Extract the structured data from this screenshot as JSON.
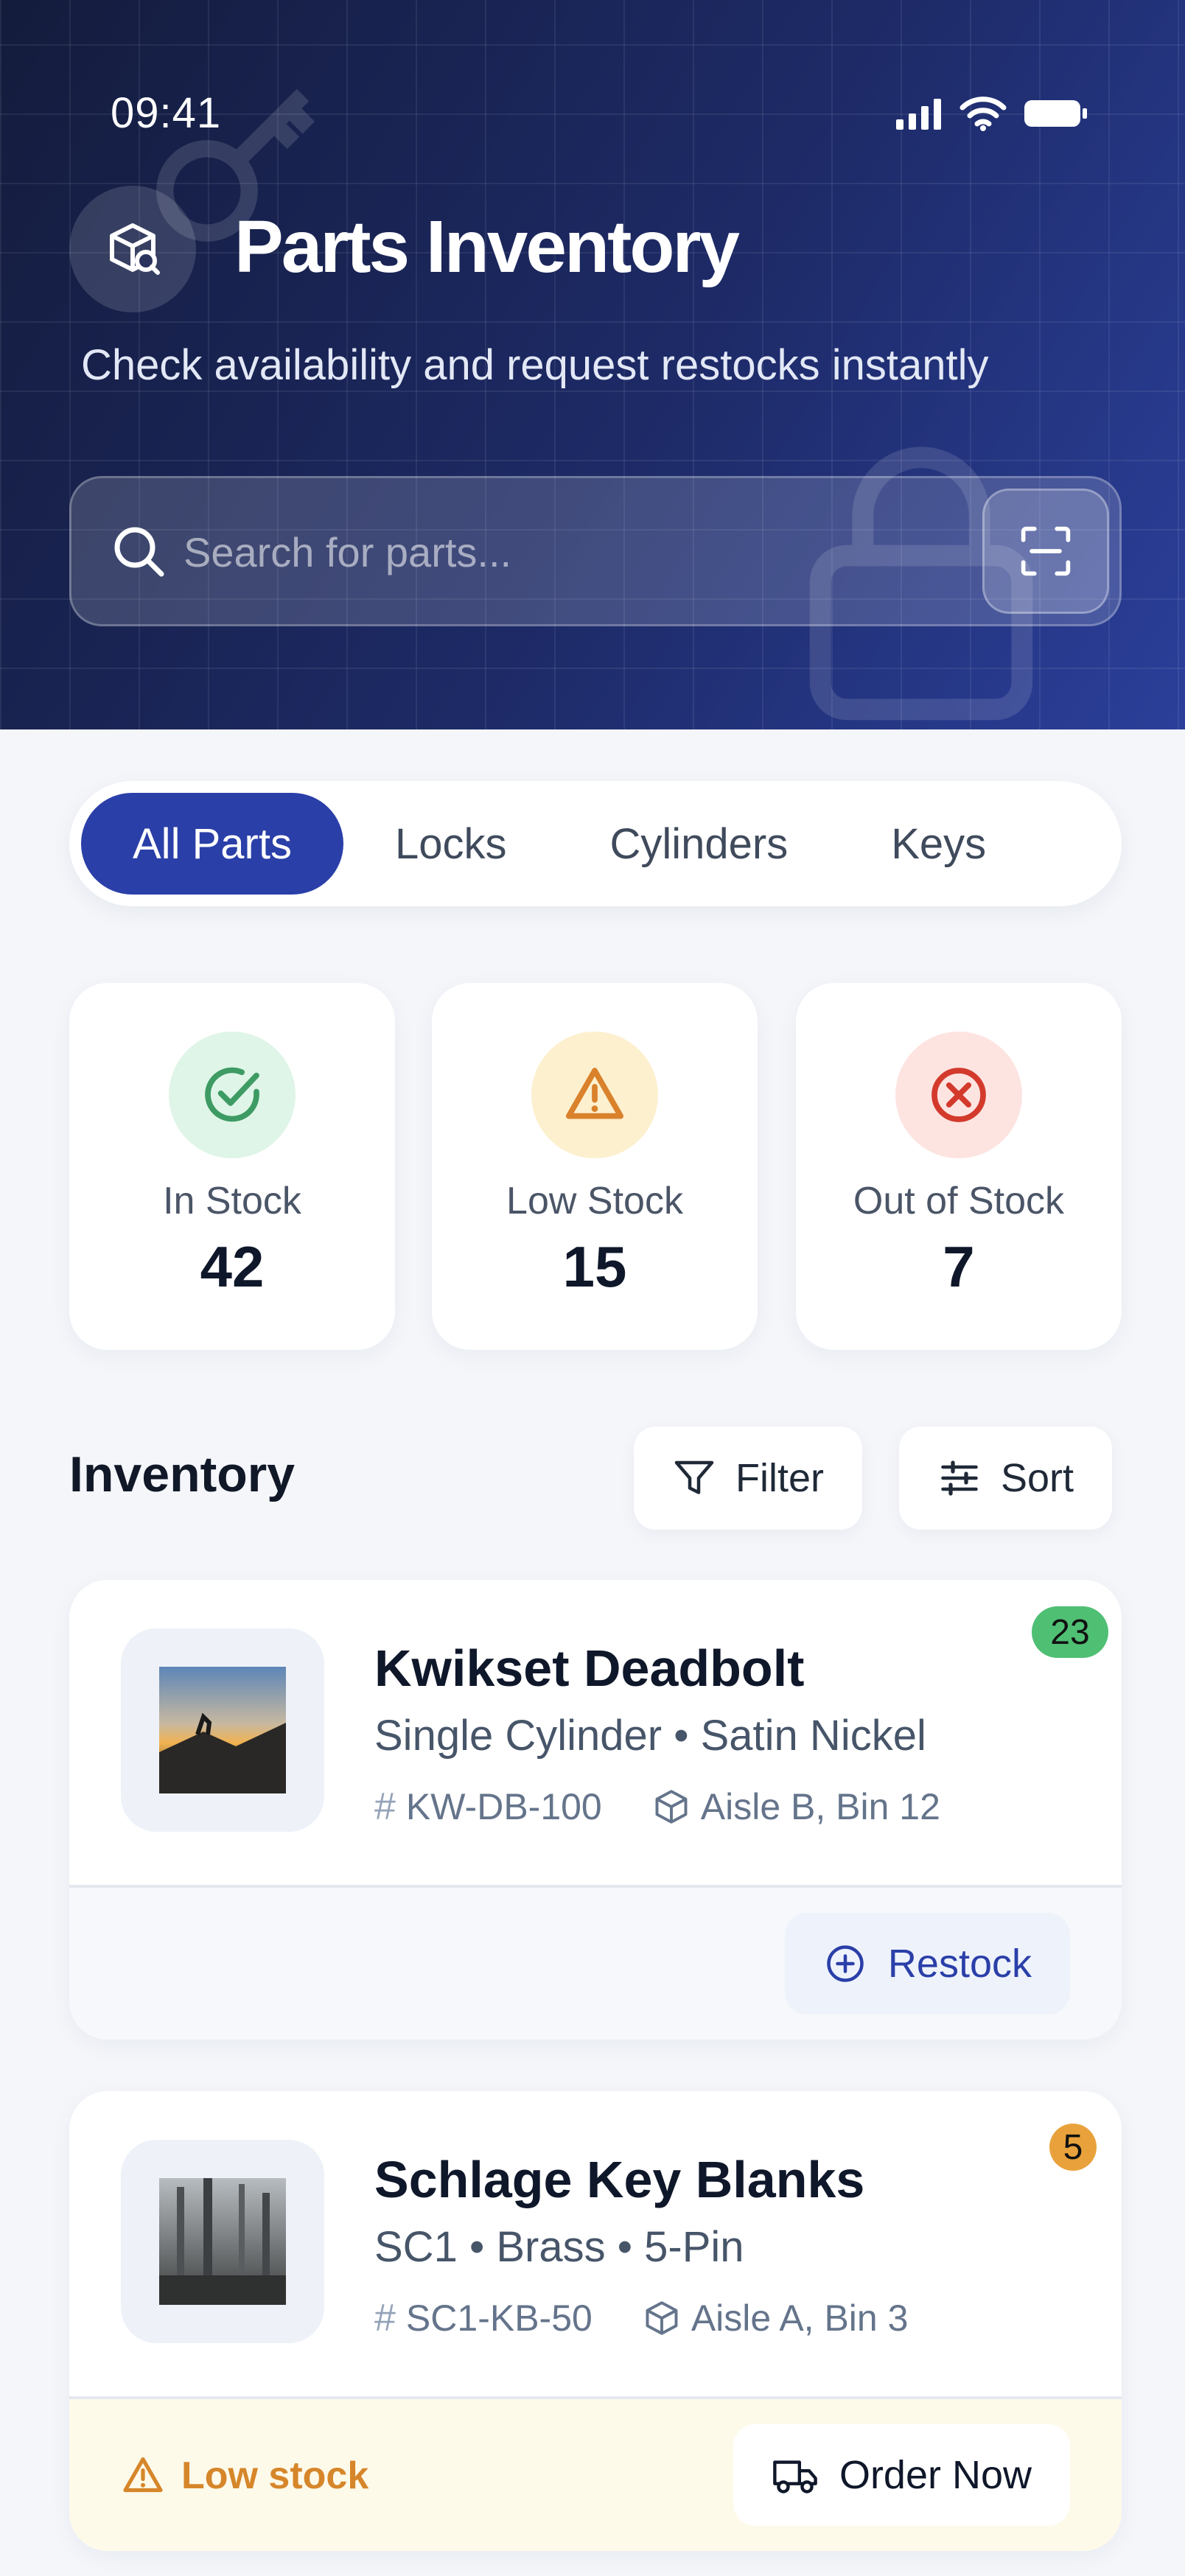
{
  "status_bar": {
    "time": "09:41"
  },
  "header": {
    "title": "Parts Inventory",
    "subtitle": "Check availability and request restocks instantly"
  },
  "search": {
    "placeholder": "Search for parts..."
  },
  "tabs": [
    {
      "label": "All Parts",
      "active": true
    },
    {
      "label": "Locks",
      "active": false
    },
    {
      "label": "Cylinders",
      "active": false
    },
    {
      "label": "Keys",
      "active": false
    }
  ],
  "stats": [
    {
      "label": "In Stock",
      "value": "42",
      "color": "#3d9b63",
      "bg": "#dff5e7",
      "icon": "check-circle-icon"
    },
    {
      "label": "Low Stock",
      "value": "15",
      "color": "#d9822b",
      "bg": "#fdf0cf",
      "icon": "warning-icon"
    },
    {
      "label": "Out of Stock",
      "value": "7",
      "color": "#d33a2c",
      "bg": "#fde4e1",
      "icon": "x-circle-icon"
    }
  ],
  "inventory": {
    "title": "Inventory",
    "filter_label": "Filter",
    "sort_label": "Sort"
  },
  "items": [
    {
      "name": "Kwikset Deadbolt",
      "spec": "Single Cylinder • Satin Nickel",
      "sku": "KW-DB-100",
      "location": "Aisle B, Bin 12",
      "qty": "23",
      "qty_color": "#4fbf74",
      "action_label": "Restock"
    },
    {
      "name": "Schlage Key Blanks",
      "spec": "SC1 • Brass • 5-Pin",
      "sku": "SC1-KB-50",
      "location": "Aisle A, Bin 3",
      "qty": "5",
      "qty_color": "#e9a23b",
      "status_label": "Low stock",
      "action_label": "Order Now"
    }
  ]
}
